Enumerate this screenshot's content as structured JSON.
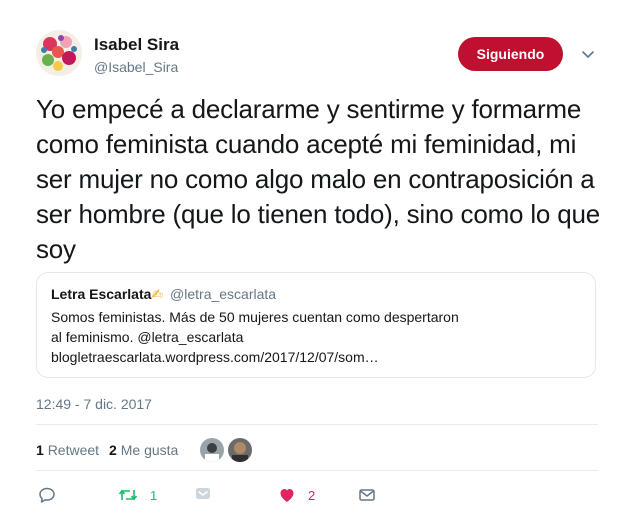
{
  "author": {
    "name": "Isabel Sira",
    "handle": "@Isabel_Sira"
  },
  "follow_button": "Siguiendo",
  "tweet_text": "Yo empecé a declararme y sentirme y formarme como feminista cuando acepté mi feminidad, mi ser mujer no como algo malo en contraposición a ser hombre (que lo tienen todo), sino como lo que soy",
  "quoted_tweet": {
    "name": "Letra Escarlata",
    "emoji": "✍",
    "handle": "@letra_escarlata",
    "text": "Somos feministas. Más de 50 mujeres cuentan como despertaron al feminismo. @letra_escarlata",
    "link": "blogletraescarlata.wordpress.com/2017/12/07/som…"
  },
  "timestamp": "12:49 - 7 dic. 2017",
  "stats": {
    "retweets_count": "1",
    "retweets_label": "Retweet",
    "likes_count": "2",
    "likes_label": "Me gusta"
  },
  "actions": {
    "retweet_count": "1",
    "like_count": "2"
  },
  "colors": {
    "follow_button_bg": "#c0102f",
    "retweet_green": "#17bf63",
    "like_red": "#e0245e",
    "secondary_text": "#657786"
  }
}
